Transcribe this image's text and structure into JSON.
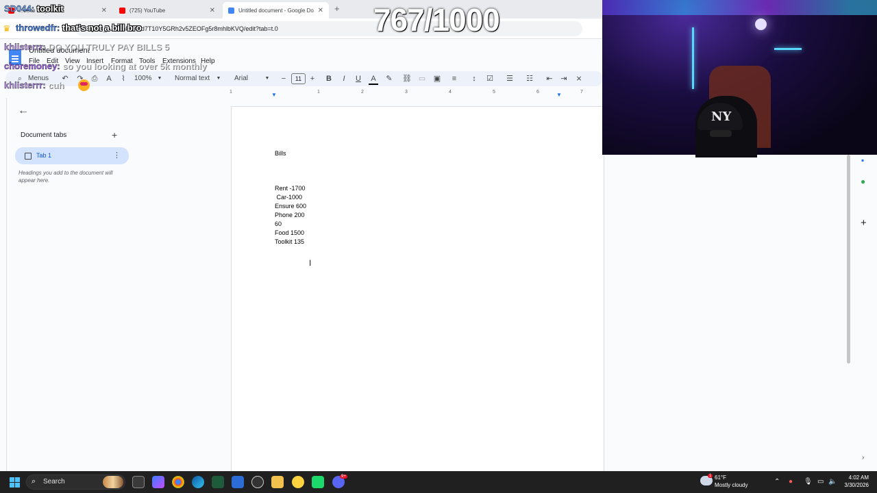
{
  "browser": {
    "tabs": [
      {
        "label": "...ee to Play",
        "color": "#ff0000"
      },
      {
        "label": "(725) YouTube",
        "color": "#ff0000"
      },
      {
        "label": "Untitled document - Google Do",
        "color": "#4285f4"
      }
    ],
    "url": "13QPAI_AZTZhPxFUd7T10Y5GRh2v5ZEOFg5r8mhlbKVQ/edit?tab=t.0"
  },
  "docs": {
    "title": "Untitled document",
    "menus": [
      "File",
      "Edit",
      "View",
      "Insert",
      "Format",
      "Tools",
      "Extensions",
      "Help"
    ],
    "toolbar": {
      "menus_label": "Menus",
      "zoom": "100%",
      "style": "Normal text",
      "font": "Arial",
      "font_size": "11",
      "minus": "−",
      "plus": "+"
    },
    "ruler_numbers": [
      "1",
      "1",
      "2",
      "3",
      "4",
      "5",
      "6",
      "7"
    ],
    "sidebar": {
      "heading": "Document tabs",
      "tab_label": "Tab 1",
      "hint": "Headings you add to the document will appear here."
    },
    "content": {
      "heading": "Bills",
      "lines": [
        "Rent -1700",
        " Car-1000",
        "Ensure 600",
        "Phone 200",
        "60",
        "Food 1500",
        "Toolkit 135"
      ]
    }
  },
  "stream": {
    "counter": "767/1000",
    "chat": [
      {
        "user": "SD044:",
        "message": "toolkit",
        "color": "#6fa8ff"
      },
      {
        "user": "throwedfr:",
        "message": "that's not a bill bro",
        "color": "#4a8cff"
      },
      {
        "user": "khlisterrr:",
        "message": "DO YOU TRULY PAY BILLS 5",
        "color": "#c9a0ff"
      },
      {
        "user": "choremoney:",
        "message": "so you looking at over 5k monthly",
        "color": "#b070ff"
      },
      {
        "user": "khlisterrr:",
        "message": "cuh",
        "color": "#c9a0ff"
      }
    ]
  },
  "taskbar": {
    "search": "Search",
    "weather_temp": "61°F",
    "weather_desc": "Mostly cloudy",
    "time": "4:02 AM",
    "date": "3/30/2026",
    "weather_badge": "1",
    "discord_badge": "9+"
  }
}
